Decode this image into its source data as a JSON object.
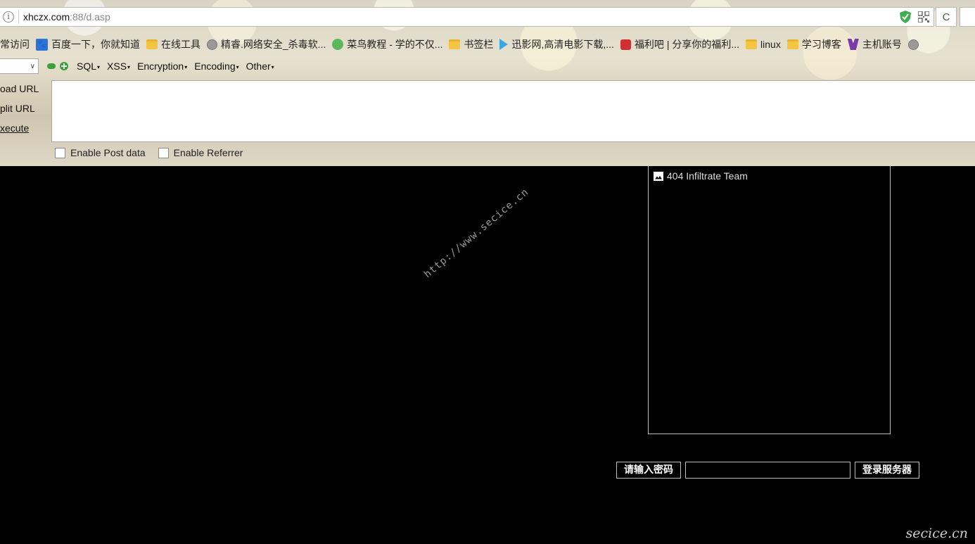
{
  "browser": {
    "url_host": "xhczx.com",
    "url_path": ":88/d.asp",
    "info_icon": "i",
    "reload_icon": "C"
  },
  "bookmarks": [
    {
      "label": "常访问",
      "icon": "none"
    },
    {
      "label": "百度一下，你就知道",
      "icon": "baidu-paw"
    },
    {
      "label": "在线工具",
      "icon": "folder"
    },
    {
      "label": "精睿.网络安全_杀毒软...",
      "icon": "globe"
    },
    {
      "label": "菜鸟教程 - 学的不仅...",
      "icon": "runoob"
    },
    {
      "label": "书签栏",
      "icon": "folder"
    },
    {
      "label": "迅影网,高清电影下载,...",
      "icon": "xunying"
    },
    {
      "label": "福利吧 | 分享你的福利...",
      "icon": "fuli"
    },
    {
      "label": "linux",
      "icon": "folder"
    },
    {
      "label": "学习博客",
      "icon": "folder"
    },
    {
      "label": "主机账号",
      "icon": "host"
    }
  ],
  "hackbar": {
    "menus": [
      {
        "label": "SQL"
      },
      {
        "label": "XSS"
      },
      {
        "label": "Encryption"
      },
      {
        "label": "Encoding"
      },
      {
        "label": "Other"
      }
    ],
    "actions": {
      "load_url": "oad URL",
      "load_url_accel": "",
      "split_url": "plit URL",
      "execute": "xecute"
    },
    "options": {
      "enable_post": "Enable Post data",
      "enable_referrer": "Enable Referrer"
    }
  },
  "page": {
    "panel_title": "404 Infiltrate Team",
    "password_label": "请输入密码",
    "login_button": "登录服务器",
    "watermark_diag": "http://www.secice.cn",
    "watermark_corner": "secice.cn"
  },
  "colors": {
    "page_background": "#000000",
    "panel_border": "#bdbdbd"
  }
}
